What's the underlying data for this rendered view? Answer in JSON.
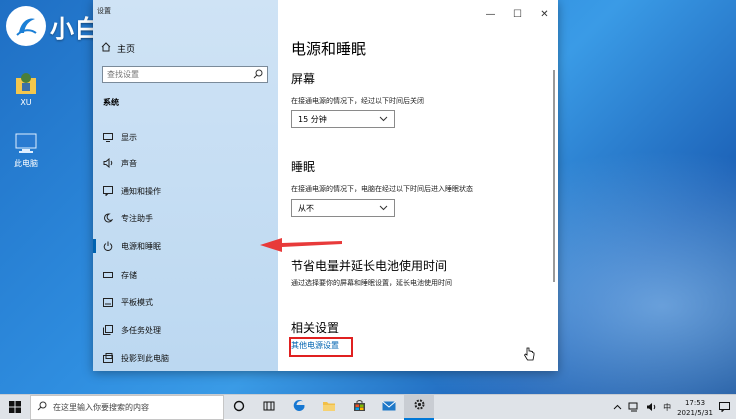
{
  "desktop": {
    "brand_logo_text": "小白系统",
    "icons": [
      {
        "label": "XU"
      },
      {
        "label": "此电脑"
      }
    ]
  },
  "window": {
    "app_title": "设置",
    "controls": {
      "minimize": "—",
      "maximize": "☐",
      "close": "✕"
    }
  },
  "sidebar": {
    "home_label": "主页",
    "search_placeholder": "查找设置",
    "section_label": "系统",
    "items": [
      {
        "label": "显示",
        "icon": "monitor-icon"
      },
      {
        "label": "声音",
        "icon": "speaker-icon"
      },
      {
        "label": "通知和操作",
        "icon": "notification-icon"
      },
      {
        "label": "专注助手",
        "icon": "moon-icon"
      },
      {
        "label": "电源和睡眠",
        "icon": "power-icon",
        "active": true
      },
      {
        "label": "存储",
        "icon": "storage-icon"
      },
      {
        "label": "平板模式",
        "icon": "tablet-icon"
      },
      {
        "label": "多任务处理",
        "icon": "multitask-icon"
      },
      {
        "label": "投影到此电脑",
        "icon": "project-icon"
      }
    ]
  },
  "content": {
    "page_title": "电源和睡眠",
    "screen": {
      "heading": "屏幕",
      "desc": "在接通电源的情况下，经过以下时间后关闭",
      "value": "15 分钟"
    },
    "sleep": {
      "heading": "睡眠",
      "desc": "在接通电源的情况下，电脑在经过以下时间后进入睡眠状态",
      "value": "从不"
    },
    "battery": {
      "heading": "节省电量并延长电池使用时间",
      "desc": "通过选择要你的屏幕和睡眠设置，延长电池使用时间"
    },
    "related": {
      "heading": "相关设置",
      "link": "其他电源设置"
    }
  },
  "taskbar": {
    "search_placeholder": "在这里输入你要搜索的内容",
    "ime": "中",
    "time": "17:53",
    "date": "2021/5/31"
  },
  "colors": {
    "accent": "#0063b1",
    "annotation": "#e02020"
  }
}
